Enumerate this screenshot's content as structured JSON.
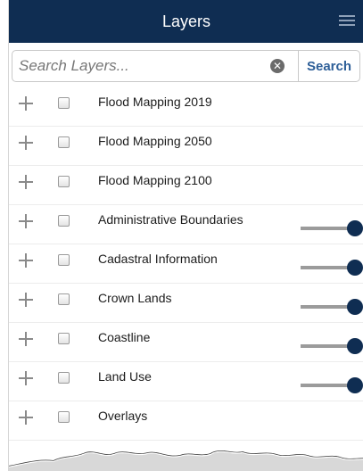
{
  "header": {
    "title": "Layers",
    "menu_icon": "hamburger-menu-icon"
  },
  "search": {
    "placeholder": "Search Layers...",
    "value": "",
    "button_label": "Search",
    "clear_icon": "clear-circle-icon",
    "clear_symbol": "✕"
  },
  "layers": [
    {
      "name": "Flood Mapping 2019",
      "checked": false,
      "opacity_slider": false
    },
    {
      "name": "Flood Mapping 2050",
      "checked": false,
      "opacity_slider": false
    },
    {
      "name": "Flood Mapping 2100",
      "checked": false,
      "opacity_slider": false
    },
    {
      "name": "Administrative Boundaries",
      "checked": false,
      "opacity_slider": true,
      "opacity": 1.0
    },
    {
      "name": "Cadastral Information",
      "checked": false,
      "opacity_slider": true,
      "opacity": 1.0
    },
    {
      "name": "Crown Lands",
      "checked": false,
      "opacity_slider": true,
      "opacity": 1.0
    },
    {
      "name": "Coastline",
      "checked": false,
      "opacity_slider": true,
      "opacity": 1.0
    },
    {
      "name": "Land Use",
      "checked": false,
      "opacity_slider": true,
      "opacity": 1.0
    },
    {
      "name": "Overlays",
      "checked": false,
      "opacity_slider": false
    }
  ],
  "colors": {
    "header_bg": "#0f2d52",
    "accent": "#2e5f98",
    "slider_thumb": "#0f2d52"
  }
}
